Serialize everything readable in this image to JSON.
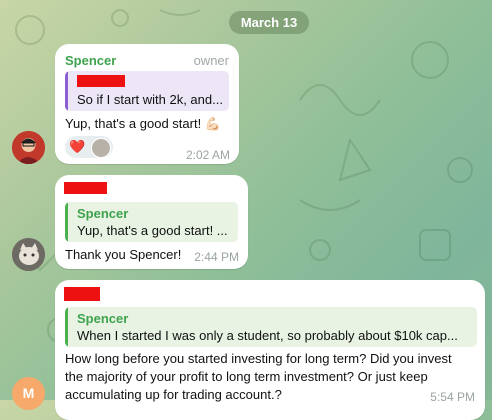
{
  "date_label": "March 13",
  "messages": [
    {
      "sender": "Spencer",
      "role": "owner",
      "reply_text": "So if I start with 2k, and...",
      "text": "Yup, that's a good start! 💪🏻",
      "reaction": "❤️",
      "time": "2:02 AM"
    },
    {
      "reply_name": "Spencer",
      "reply_text": "Yup, that's a good start! ...",
      "text": "Thank you Spencer!",
      "time": "2:44 PM"
    },
    {
      "reply_name": "Spencer",
      "reply_text": "When I started I was only a student, so probably about $10k cap...",
      "text_lines": [
        "How long before you started investing for long term? Did you invest",
        "the majority of your  profit to long term investment? Or just keep",
        "accumulating up for trading account.?"
      ],
      "time": "5:54 PM",
      "avatar_letter": "M"
    }
  ],
  "colors": {
    "green_name": "#3fa34d",
    "purple_bar": "#8b5fd3",
    "purple_bg": "#ece6f7",
    "green_bar": "#4caf50",
    "green_bg": "#e8f3e4",
    "redact": "#ee1111",
    "avatar_orange": "#f6a96a"
  }
}
